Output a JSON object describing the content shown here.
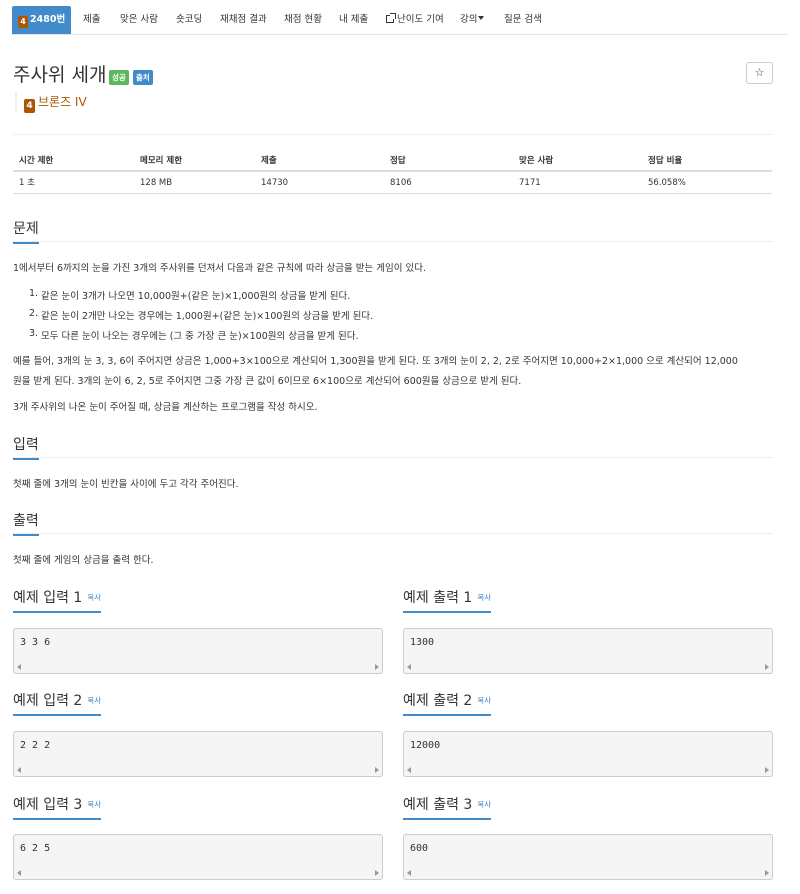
{
  "nav": {
    "problem_tier": "4",
    "problem_number": "2480번",
    "tabs": [
      "제출",
      "맞은 사람",
      "숏코딩",
      "재채점 결과",
      "채점 현황",
      "내 제출",
      "난이도 기여",
      "강의",
      "질문 검색"
    ]
  },
  "title": "주사위 세개",
  "labels": {
    "solved": "성공",
    "source": "출처"
  },
  "star_icon": "☆",
  "tier": {
    "badge": "4",
    "name": "브론즈 IV",
    "color": "#ad5600"
  },
  "info_table": {
    "headers": [
      "시간 제한",
      "메모리 제한",
      "제출",
      "정답",
      "맞은 사람",
      "정답 비율"
    ],
    "values": [
      "1 초",
      "128 MB",
      "14730",
      "8106",
      "7171",
      "56.058%"
    ]
  },
  "problem": {
    "heading": "문제",
    "intro": "1에서부터 6까지의 눈을 가진 3개의 주사위를 던져서 다음과 같은 규칙에 따라 상금을 받는 게임이 있다.",
    "rules": [
      "같은 눈이 3개가 나오면 10,000원+(같은 눈)×1,000원의 상금을 받게 된다.",
      "같은 눈이 2개만 나오는 경우에는 1,000원+(같은 눈)×100원의 상금을 받게 된다.",
      "모두 다른 눈이 나오는 경우에는 (그 중 가장 큰 눈)×100원의 상금을 받게 된다."
    ],
    "example_line1": "예를 들어, 3개의 눈 3, 3, 6이 주어지면 상금은 1,000+3×100으로 계산되어 1,300원을 받게 된다. 또 3개의 눈이 2, 2, 2로 주어지면 10,000+2×1,000 으로 계산되어 12,000",
    "example_line2": "원을 받게 된다. 3개의 눈이 6, 2, 5로 주어지면 그중 가장 큰 값이 6이므로 6×100으로 계산되어 600원을 상금으로 받게 된다.",
    "task": "3개 주사위의 나온 눈이 주어질 때, 상금을 계산하는 프로그램을 작성 하시오."
  },
  "input": {
    "heading": "입력",
    "text": "첫째 줄에 3개의 눈이 빈칸을 사이에 두고 각각 주어진다."
  },
  "output": {
    "heading": "출력",
    "text": "첫째 줄에 게임의 상금을 출력 한다."
  },
  "copy_label": "복사",
  "samples": [
    {
      "in_title": "예제 입력 1",
      "in": "3 3 6",
      "out_title": "예제 출력 1",
      "out": "1300"
    },
    {
      "in_title": "예제 입력 2",
      "in": "2 2 2",
      "out_title": "예제 출력 2",
      "out": "12000"
    },
    {
      "in_title": "예제 입력 3",
      "in": "6 2 5",
      "out_title": "예제 출력 3",
      "out": "600"
    }
  ],
  "colors": {
    "primary": "#428bca",
    "success": "#5cb85c",
    "info": "#428bca",
    "bronze": "#ad5600"
  }
}
